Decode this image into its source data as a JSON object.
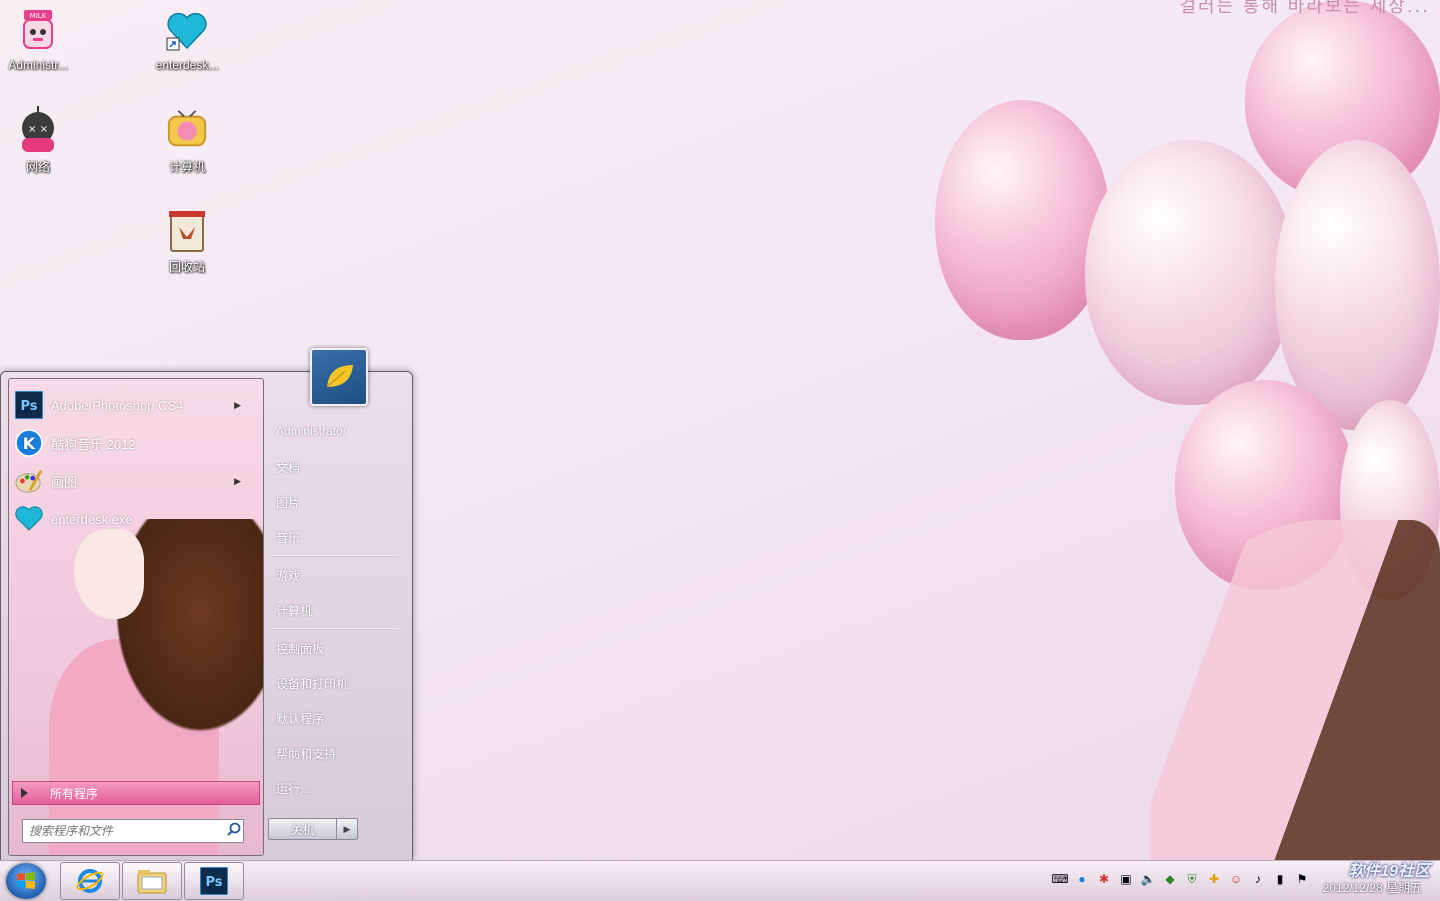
{
  "wallpaper": {
    "corner_text": "걸러는 통해 바라보는 세상..."
  },
  "desktop_icons": [
    {
      "label": "Administr...",
      "icon": "milk-user-icon"
    },
    {
      "label": "enterdesk...",
      "icon": "heart-shortcut-icon"
    },
    {
      "label": "网络",
      "icon": "network-icon"
    },
    {
      "label": "计算机",
      "icon": "computer-icon"
    },
    {
      "label": "回收站",
      "icon": "recycle-bin-icon"
    }
  ],
  "start_menu": {
    "programs": [
      {
        "label": "Adobe Photoshop CS4",
        "icon": "photoshop-icon",
        "has_submenu": true
      },
      {
        "label": "酷狗音乐 2012",
        "icon": "kugou-icon",
        "has_submenu": false
      },
      {
        "label": "画图",
        "icon": "paint-icon",
        "has_submenu": true
      },
      {
        "label": "enterdesk.exe",
        "icon": "heart-icon",
        "has_submenu": false
      }
    ],
    "all_programs": "所有程序",
    "search_placeholder": "搜索程序和文件",
    "right_links": {
      "user": "Administrator",
      "documents": "文档",
      "pictures": "图片",
      "music": "音乐",
      "games": "游戏",
      "computer": "计算机",
      "control_panel": "控制面板",
      "devices": "设备和打印机",
      "default_programs": "默认程序",
      "help": "帮助和支持",
      "run": "运行..."
    },
    "shutdown": "关机"
  },
  "taskbar": {
    "pinned": [
      {
        "name": "ie-icon"
      },
      {
        "name": "explorer-icon"
      },
      {
        "name": "photoshop-icon"
      }
    ],
    "clock": "2012/12/28 星期五",
    "logo": "软件19社区"
  }
}
